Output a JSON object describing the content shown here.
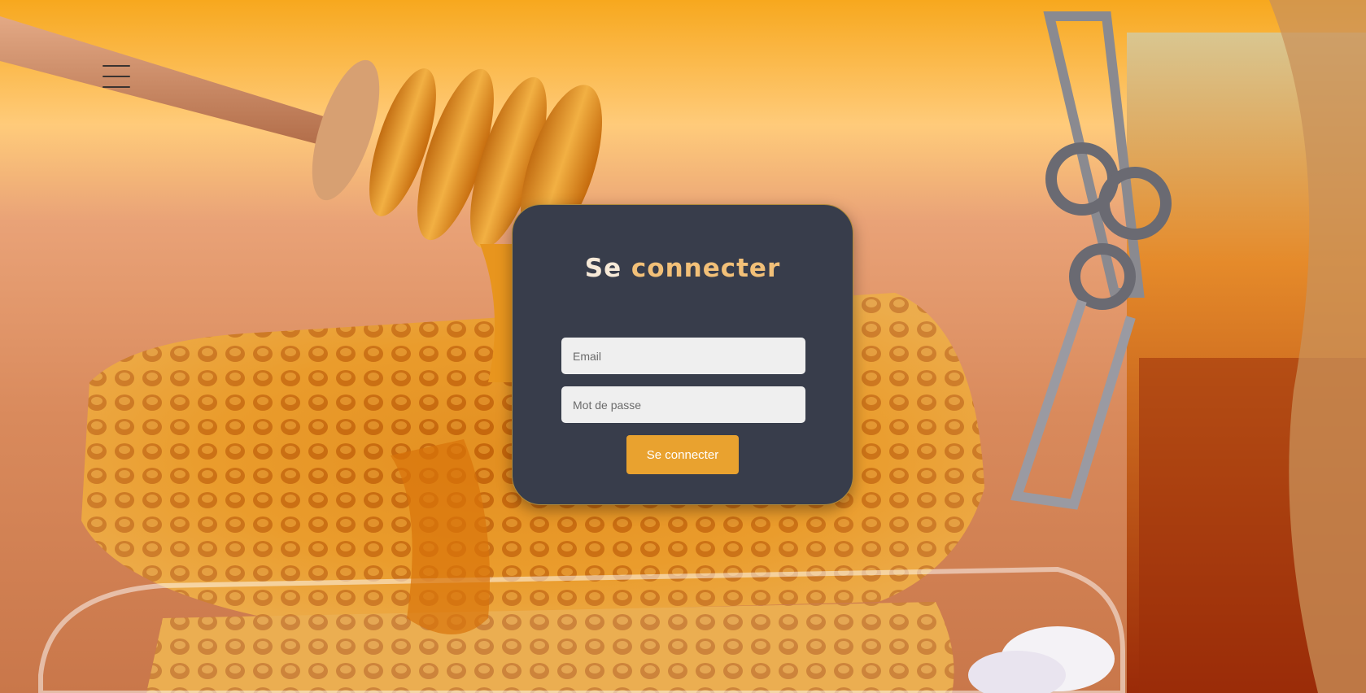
{
  "menu": {
    "icon": "hamburger-menu-icon"
  },
  "login": {
    "title_first": "Se",
    "title_rest": " connecter",
    "email_placeholder": "Email",
    "password_placeholder": "Mot de passe",
    "submit_label": "Se connecter"
  },
  "colors": {
    "card_background": "#383d4b",
    "accent": "#e9a22f",
    "title_color": "#f2c078",
    "field_background": "#efefef"
  },
  "background": {
    "subject": "honey-dipper-honeycomb-and-jar-photo"
  }
}
